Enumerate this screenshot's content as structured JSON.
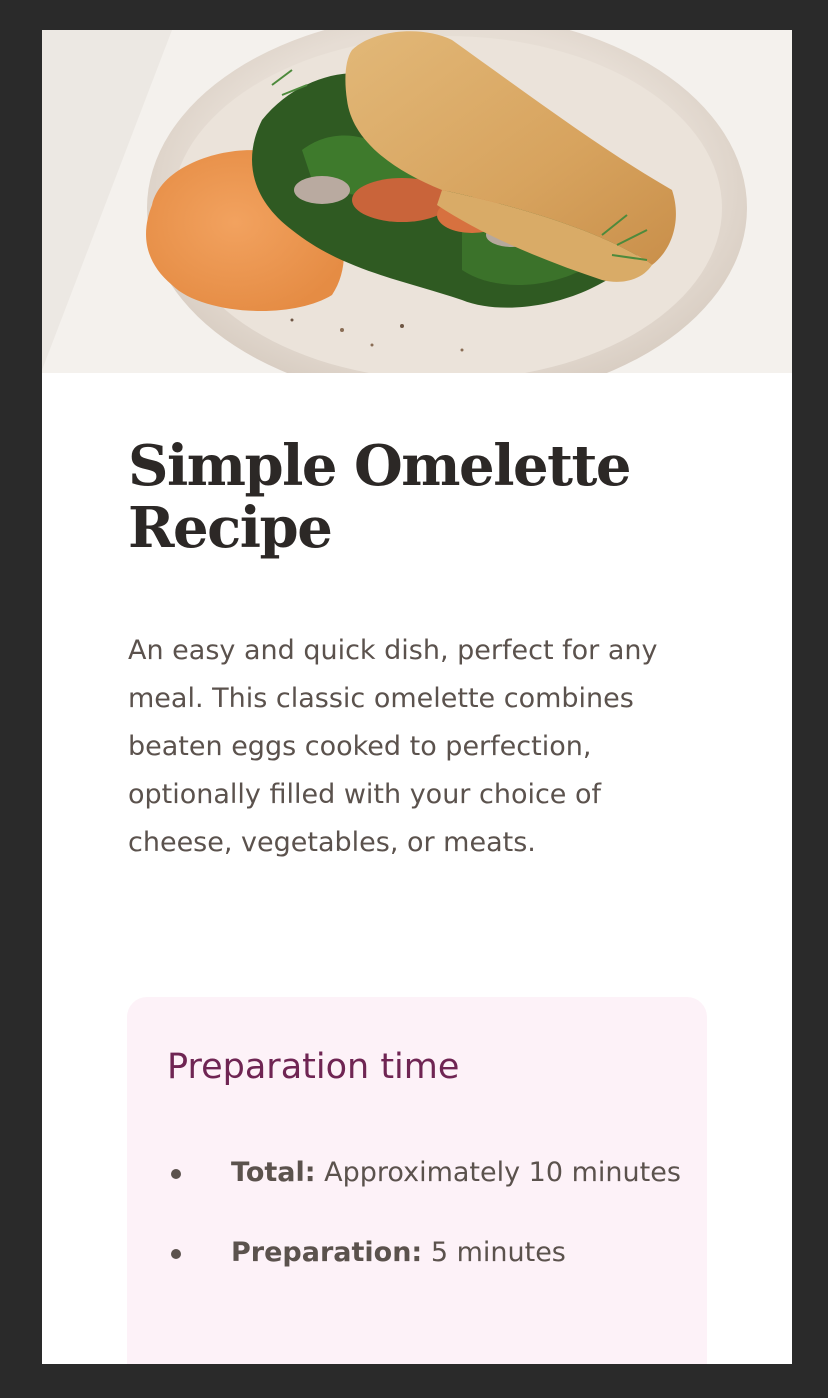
{
  "hero": {
    "image_alt": "omelette-dish-photo"
  },
  "recipe": {
    "title": "Simple Omelette Recipe",
    "description": "An easy and quick dish, perfect for any meal. This classic omelette combines beaten eggs cooked to perfection, optionally filled with your choice of cheese, vegetables, or meats."
  },
  "preparation": {
    "heading": "Preparation time",
    "items": [
      {
        "label": "Total:",
        "value": " Approximately 10 minutes"
      },
      {
        "label": "Preparation:",
        "value": " 5 minutes"
      }
    ]
  },
  "colors": {
    "page_bg": "#2a2a2a",
    "card_bg": "#ffffff",
    "title_text": "#2c2826",
    "body_text": "#5b524d",
    "prep_bg": "#fdf2f8",
    "prep_heading": "#6f2553"
  }
}
